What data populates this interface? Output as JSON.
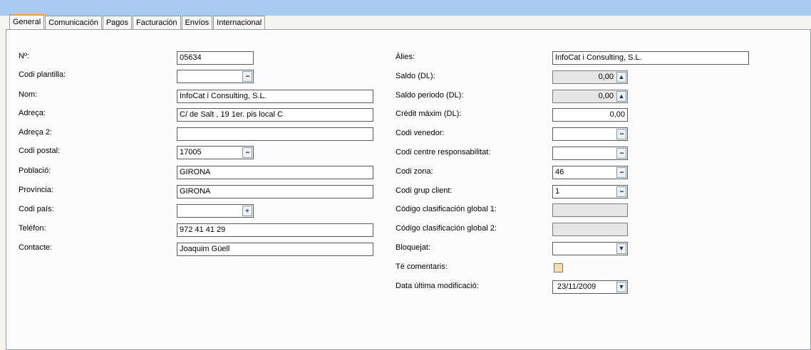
{
  "tabs": [
    "General",
    "Comunicación",
    "Pagos",
    "Facturación",
    "Envíos",
    "Internacional"
  ],
  "left_labels": {
    "numero": "Nº:",
    "codi_plantilla": "Codi plantilla:",
    "nom": "Nom:",
    "adreca": "Adreça:",
    "adreca2": "Adreça 2:",
    "codi_postal": "Codi postal:",
    "poblacio": "Població:",
    "provincia": "Província:",
    "codi_pais": "Codi país:",
    "telefon": "Telèfon:",
    "contacte": "Contacte:"
  },
  "left_values": {
    "numero": "05634",
    "codi_plantilla": "",
    "nom": "InfoCat i Consulting, S.L.",
    "adreca": "C/ de Salt , 19 1er. pis local C",
    "adreca2": "",
    "codi_postal": "17005",
    "poblacio": "GIRONA",
    "provincia": "GIRONA",
    "codi_pais": "",
    "telefon": "972 41 41 29",
    "contacte": "Joaquim Güell"
  },
  "right_labels": {
    "alies": "Àlies:",
    "saldo": "Saldo (DL):",
    "saldo_periodo": "Saldo periodo (DL):",
    "credit_maxim": "Crèdit màxim (DL):",
    "codi_venedor": "Codi venedor:",
    "codi_centre": "Codi centre responsabilitat:",
    "codi_zona": "Codi zona:",
    "codi_grup": "Codi grup client:",
    "clasif1": "Código clasificación global 1:",
    "clasif2": "Código clasificación global 2:",
    "bloquejat": "Bloquejat:",
    "te_comentaris": "Té comentaris:",
    "data_modif": "Data última modificació:"
  },
  "right_values": {
    "alies": "InfoCat i Consulting, S.L.",
    "saldo": "0,00",
    "saldo_periodo": "0,00",
    "credit_maxim": "0,00",
    "codi_venedor": "",
    "codi_centre": "",
    "codi_zona": "46",
    "codi_grup": "1",
    "clasif1": "",
    "clasif2": "",
    "bloquejat": "",
    "data_modif": "23/11/2009"
  },
  "buttons": {
    "ellipsis": "...",
    "spin_up": "▲",
    "plus": "+",
    "dropdown": "▼"
  }
}
